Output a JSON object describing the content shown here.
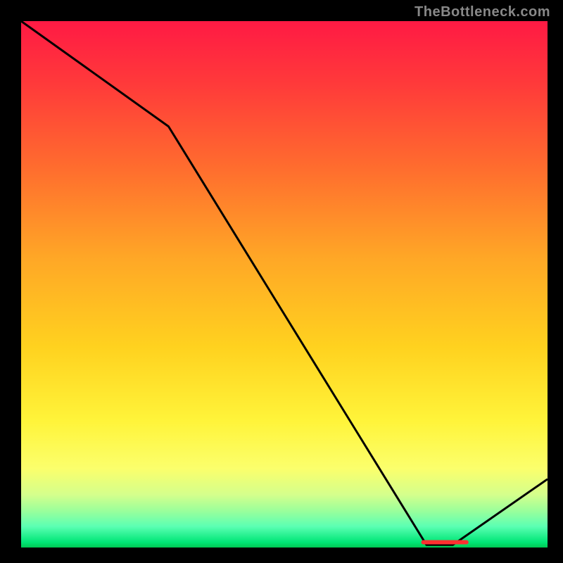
{
  "watermark": "TheBottleneck.com",
  "chart_data": {
    "type": "line",
    "title": "",
    "xlabel": "",
    "ylabel": "",
    "x_range": [
      0,
      100
    ],
    "y_range": [
      0,
      100
    ],
    "series": [
      {
        "name": "curve",
        "color": "#000000",
        "x": [
          0,
          28,
          77,
          82,
          100
        ],
        "y": [
          100,
          80,
          0.5,
          0.5,
          13
        ]
      }
    ],
    "marker": {
      "name": "optimum-marker",
      "text": "",
      "color": "#ff3030",
      "x_start": 76,
      "x_end": 85,
      "y": 1
    },
    "background_gradient": {
      "top": "#ff1a44",
      "bottom": "#00c853",
      "meaning": "red high / green low"
    }
  }
}
